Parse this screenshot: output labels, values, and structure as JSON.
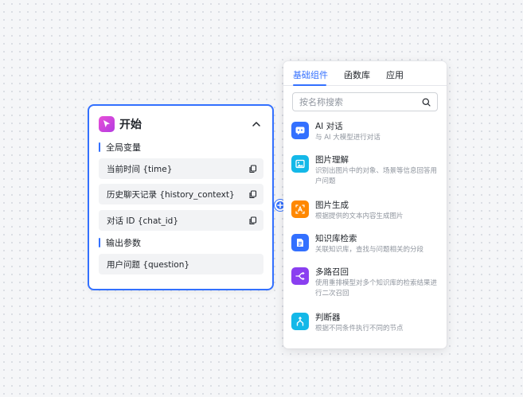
{
  "start_node": {
    "title": "开始",
    "global_vars_label": "全局变量",
    "global_vars": [
      "当前时间 {time}",
      "历史聊天记录 {history_context}",
      "对话 ID {chat_id}"
    ],
    "output_params_label": "输出参数",
    "output_params": [
      "用户问题 {question}"
    ]
  },
  "panel": {
    "tabs": [
      "基础组件",
      "函数库",
      "应用"
    ],
    "active_tab": 0,
    "search": {
      "placeholder": "按名称搜索",
      "value": ""
    },
    "components": [
      {
        "name": "AI 对话",
        "desc": "与 AI 大模型进行对话",
        "icon": "ai-chat-icon",
        "color": "#3370ff"
      },
      {
        "name": "图片理解",
        "desc": "识别出图片中的对象、场景等信息回答用户问题",
        "icon": "image-understand-icon",
        "color": "#14b8e8"
      },
      {
        "name": "图片生成",
        "desc": "根据提供的文本内容生成图片",
        "icon": "image-generate-icon",
        "color": "#ff8800"
      },
      {
        "name": "知识库检索",
        "desc": "关联知识库，查找与问题相关的分段",
        "icon": "knowledge-search-icon",
        "color": "#3370ff"
      },
      {
        "name": "多路召回",
        "desc": "使用重排模型对多个知识库的检索结果进行二次召回",
        "icon": "multi-recall-icon",
        "color": "#8a3ff0"
      },
      {
        "name": "判断器",
        "desc": "根据不同条件执行不同的节点",
        "icon": "condition-icon",
        "color": "#14b8e8"
      }
    ]
  }
}
